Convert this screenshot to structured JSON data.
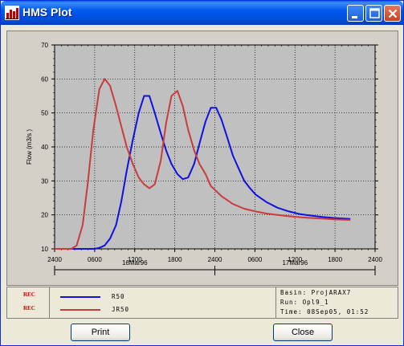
{
  "window": {
    "title": "HMS Plot"
  },
  "buttons": {
    "print": "Print",
    "close": "Close"
  },
  "colors": {
    "series_r50": "#1010E0",
    "series_jr50": "#C83C3C",
    "plot_bg": "#C0C0C0"
  },
  "legend": {
    "tags": [
      "REC",
      "REC"
    ],
    "entries": [
      {
        "label": "R50",
        "color": "#1010E0"
      },
      {
        "label": "JR50",
        "color": "#C83C3C"
      }
    ],
    "info": {
      "basin": "Basin: ProjARAX7",
      "run": "Run:   Opl9_1",
      "time": "Time:  08Sep05, 01:52"
    }
  },
  "chart_data": {
    "type": "line",
    "ylabel": "Flow (m3/s   )",
    "ylim": [
      10,
      70
    ],
    "yticks": [
      10,
      20,
      30,
      40,
      50,
      60,
      70
    ],
    "xlim": [
      0,
      48
    ],
    "xticks": [
      0,
      6,
      12,
      18,
      24,
      30,
      36,
      42,
      48
    ],
    "xtick_labels": [
      "2400",
      "0600",
      "1200",
      "1800",
      "2400",
      "0600",
      "1200",
      "1800",
      "2400"
    ],
    "date_labels": [
      "16Mar96",
      "17Mar96"
    ],
    "grid": true,
    "series": [
      {
        "name": "R50",
        "color": "#1010E0",
        "x": [
          0,
          6,
          6.7,
          7.5,
          8.3,
          9.2,
          10.0,
          10.8,
          11.7,
          12.6,
          13.4,
          14.2,
          15.0,
          15.9,
          16.7,
          17.5,
          18.4,
          19.2,
          20.0,
          20.9,
          21.7,
          22.6,
          23.4,
          24.2,
          25.0,
          25.9,
          26.7,
          27.6,
          28.4,
          29.2,
          30.1,
          31.7,
          33.4,
          35.1,
          36.8,
          38.4,
          40.1,
          41.8,
          44.3
        ],
        "y": [
          10,
          10,
          10.3,
          11,
          13,
          17,
          24,
          33,
          42,
          50,
          55,
          55,
          50,
          44,
          39,
          35,
          32,
          30.5,
          31,
          35,
          41,
          47.5,
          51.5,
          51.5,
          48,
          42.5,
          37.5,
          33.5,
          30,
          28,
          26,
          23.8,
          22.1,
          21,
          20.2,
          19.8,
          19.4,
          19.1,
          18.8
        ]
      },
      {
        "name": "JR50",
        "color": "#C83C3C",
        "x": [
          0,
          2.5,
          3.3,
          4.2,
          5.0,
          5.8,
          6.7,
          7.5,
          8.3,
          9.2,
          10.0,
          10.8,
          11.7,
          12.6,
          13.4,
          14.2,
          15.0,
          15.9,
          16.7,
          17.5,
          18.4,
          19.2,
          20.0,
          20.9,
          21.7,
          22.6,
          23.4,
          24.2,
          25.0,
          26.7,
          28.4,
          30.1,
          31.7,
          33.4,
          35.1,
          36.8,
          38.4,
          40.1,
          41.8,
          44.3
        ],
        "y": [
          10,
          10,
          11,
          17,
          30,
          45,
          57,
          60,
          58,
          52,
          46,
          40,
          35,
          31,
          29,
          27.8,
          29,
          36,
          47,
          55,
          56.5,
          52,
          45,
          39,
          35,
          32,
          28.5,
          27,
          25.5,
          23.2,
          21.8,
          21,
          20.4,
          20,
          19.6,
          19.3,
          19.1,
          18.9,
          18.7,
          18.5
        ]
      }
    ]
  }
}
